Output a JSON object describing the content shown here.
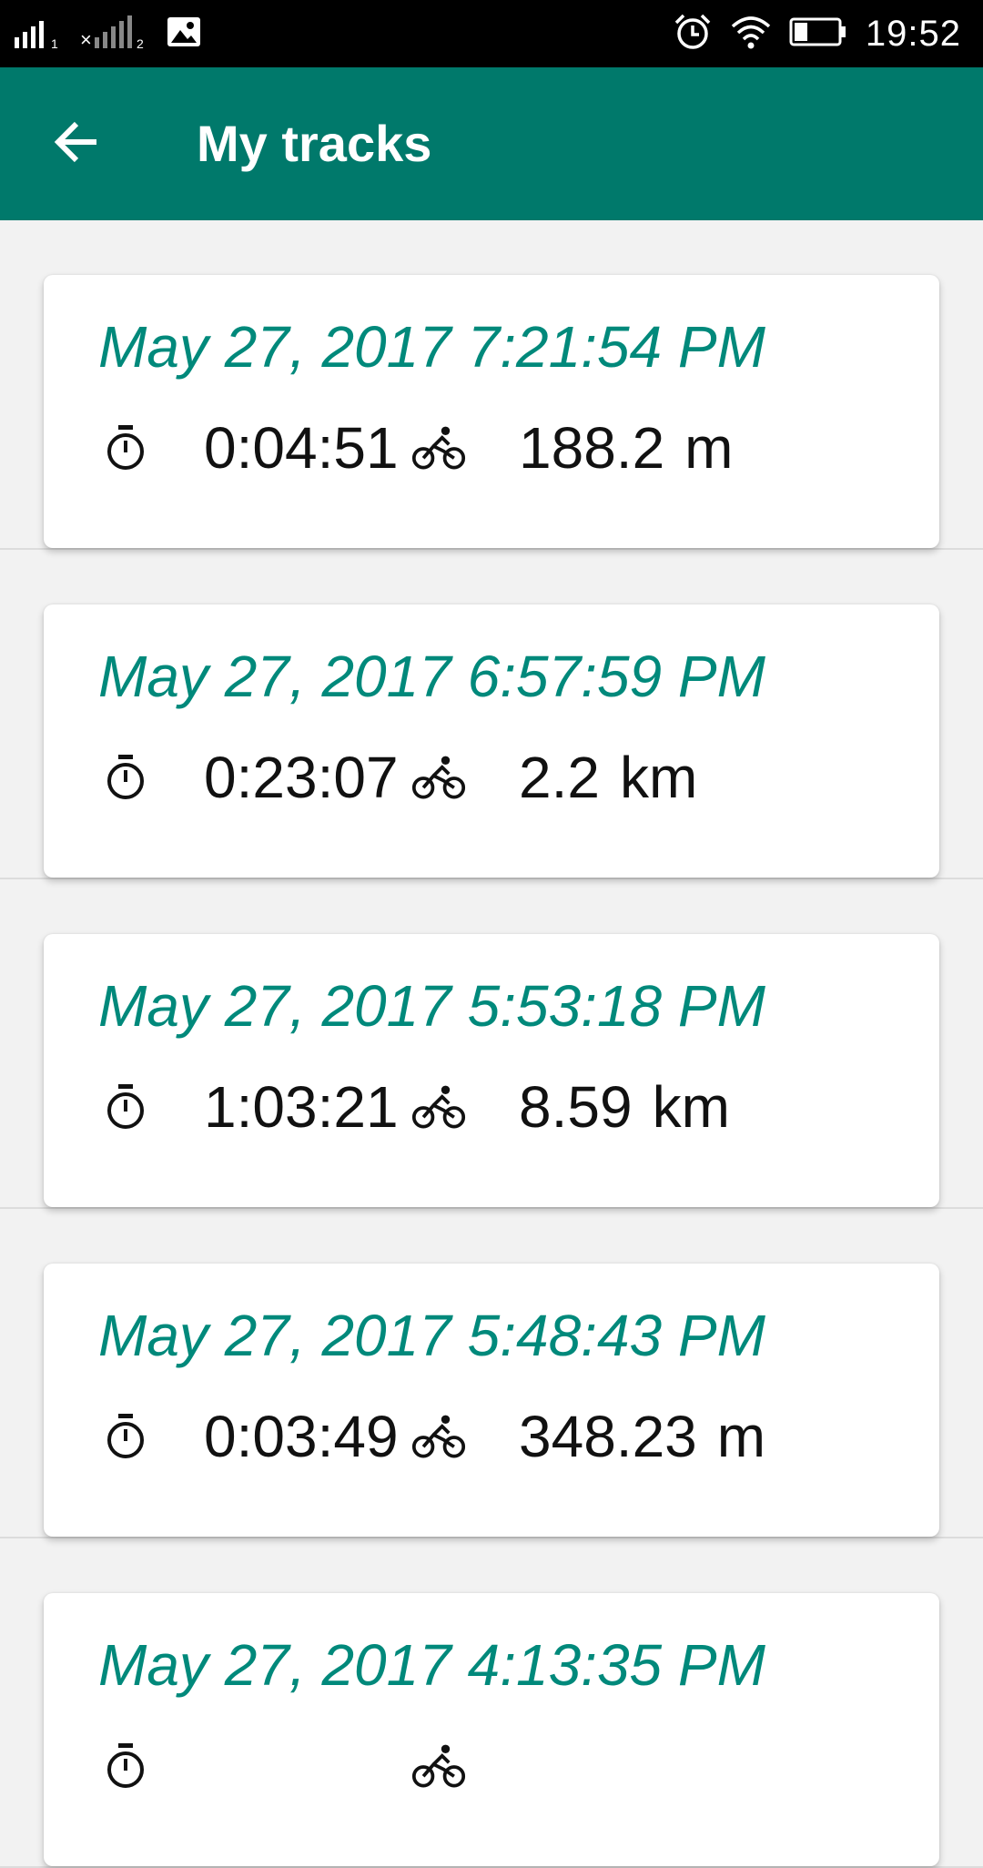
{
  "status_bar": {
    "time": "19:52",
    "sim1_label": "1",
    "sim2_label": "2",
    "icons": [
      "signal-icon",
      "signal-off-icon",
      "gallery-icon",
      "alarm-icon",
      "wifi-icon",
      "battery-icon"
    ]
  },
  "toolbar": {
    "title": "My tracks",
    "background": "#00796b",
    "back_icon": "arrow-left-icon"
  },
  "tracks": [
    {
      "date": "May 27, 2017 7:21:54 PM",
      "duration": "0:04:51",
      "distance_value": "188.2",
      "distance_unit": "m"
    },
    {
      "date": "May 27, 2017 6:57:59 PM",
      "duration": "0:23:07",
      "distance_value": "2.2",
      "distance_unit": "km"
    },
    {
      "date": "May 27, 2017 5:53:18 PM",
      "duration": "1:03:21",
      "distance_value": "8.59",
      "distance_unit": "km"
    },
    {
      "date": "May 27, 2017 5:48:43 PM",
      "duration": "0:03:49",
      "distance_value": "348.23",
      "distance_unit": "m"
    },
    {
      "date": "May 27, 2017 4:13:35 PM",
      "duration": "",
      "distance_value": "",
      "distance_unit": ""
    }
  ],
  "colors": {
    "accent": "#00897b",
    "primary": "#00796b",
    "status_bar": "#000000",
    "list_background": "#f2f2f2"
  }
}
